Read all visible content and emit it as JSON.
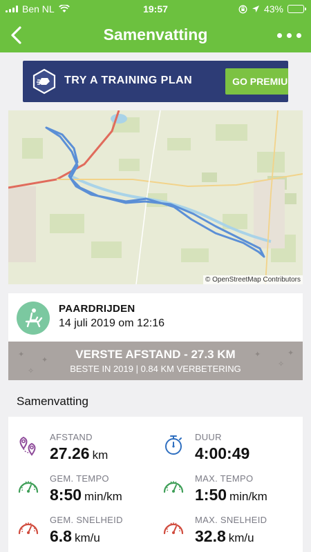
{
  "status_bar": {
    "carrier": "Ben NL",
    "time": "19:57",
    "battery": "43%",
    "battery_level": 0.43
  },
  "nav": {
    "title": "Samenvatting",
    "back_icon": "back-chevron-icon",
    "more_icon": "more-dots-icon"
  },
  "banner": {
    "text": "TRY A TRAINING PLAN",
    "button": "GO PREMIUM",
    "icon": "training-shield-icon"
  },
  "map": {
    "attribution": "© OpenStreetMap Contributors"
  },
  "activity": {
    "type": "PAARDRIJDEN",
    "date": "14 juli 2019 om 12:16",
    "icon": "horse-riding-icon"
  },
  "record": {
    "title": "VERSTE AFSTAND - 27.3 KM",
    "subtitle": "BESTE IN 2019  |  0.84 KM VERBETERING"
  },
  "summary": {
    "section_title": "Samenvatting",
    "stats": [
      {
        "label": "AFSTAND",
        "value": "27.26",
        "unit": "km",
        "icon": "distance-pins-icon"
      },
      {
        "label": "DUUR",
        "value": "4:00:49",
        "unit": "",
        "icon": "stopwatch-icon"
      },
      {
        "label": "GEM. TEMPO",
        "value": "8:50",
        "unit": "min/km",
        "icon": "pace-gauge-icon"
      },
      {
        "label": "MAX. TEMPO",
        "value": "1:50",
        "unit": "min/km",
        "icon": "pace-gauge-icon"
      },
      {
        "label": "GEM. SNELHEID",
        "value": "6.8",
        "unit": "km/u",
        "icon": "speed-gauge-icon"
      },
      {
        "label": "MAX. SNELHEID",
        "value": "32.8",
        "unit": "km/u",
        "icon": "speed-gauge-icon"
      }
    ]
  },
  "colors": {
    "brand_green": "#6cc13f",
    "banner_navy": "#2d3c76",
    "premium_green": "#7cc243",
    "route_blue": "#5b8fd6",
    "record_grey": "#aaa4a1",
    "activity_teal": "#7bc8a0",
    "distance_purple": "#8e4a9a",
    "duration_blue": "#2f6fc0",
    "pace_green": "#3e9e57",
    "speed_red": "#d04a3c"
  }
}
